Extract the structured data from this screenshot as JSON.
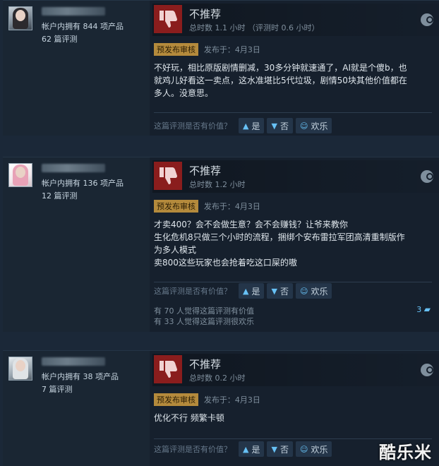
{
  "labels": {
    "helpful_question": "这篇评测是否有价值？",
    "yes": "是",
    "no": "否",
    "funny": "欢乐",
    "not_recommended": "不推荐",
    "early_access_badge": "预发布审核"
  },
  "reviews": [
    {
      "products_owned": "帐户内拥有 844 项产品",
      "review_count": "62 篇评测",
      "hours": "总时数 1.1 小时 （评测时 0.6 小时）",
      "posted": "发布于：4月3日",
      "body_lines": [
        "不好玩，相比原版剧情删减，30多分钟就速通了，AI就是个傻b，也",
        "就鸡儿好看这一卖点，这水准堪比5代垃圾，剧情50块其他价值都在",
        "多人。没意思。"
      ]
    },
    {
      "products_owned": "帐户内拥有 136 项产品",
      "review_count": "12 篇评测",
      "hours": "总时数 1.2 小时",
      "posted": "发布于：4月3日",
      "body_lines": [
        "才卖400？会不会做生意？会不会赚钱？让爷来教你",
        "生化危机8只做三个小时的流程，捆绑个安布雷拉军团高清重制版作",
        "为多人模式",
        "卖800这些玩家也会抢着吃这口屎的嗷"
      ],
      "helpful_stat": "有 70 人觉得这篇评测有价值",
      "funny_stat": "有 33 人觉得这篇评测很欢乐",
      "comments": "3"
    },
    {
      "products_owned": "帐户内拥有 38 项产品",
      "review_count": "7 篇评测",
      "hours": "总时数 0.2 小时",
      "posted": "发布于：4月3日",
      "body_lines": [
        "优化不行 频繁卡顿"
      ]
    }
  ],
  "watermark": "酷乐米"
}
